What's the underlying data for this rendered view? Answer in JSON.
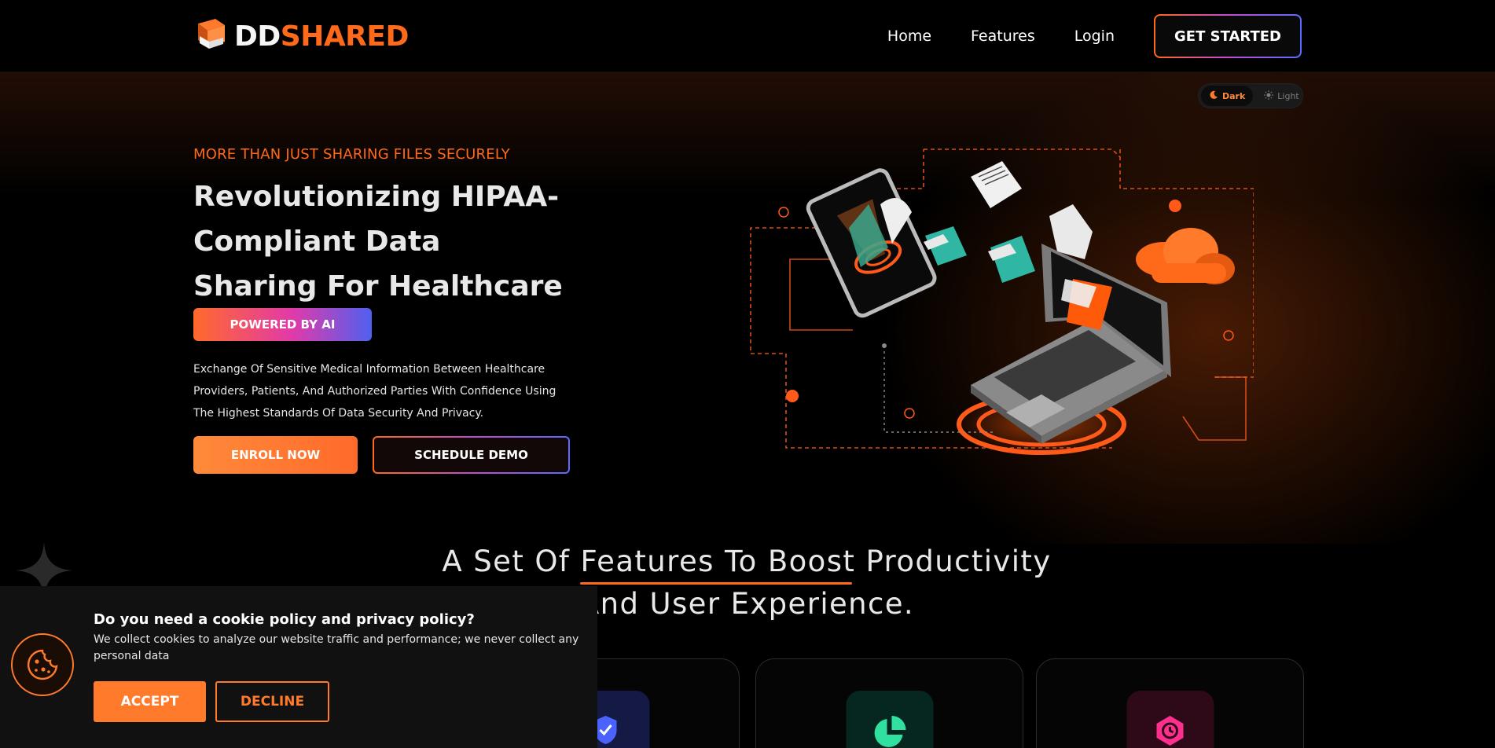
{
  "header": {
    "logo": {
      "part1": "DD",
      "part2": "SHARED"
    },
    "nav": {
      "home": "Home",
      "features": "Features",
      "login": "Login",
      "cta": "GET STARTED"
    }
  },
  "theme_toggle": {
    "dark_label": "Dark",
    "light_label": "Light",
    "selected": "Dark"
  },
  "hero": {
    "eyebrow": "MORE THAN JUST SHARING FILES SECURELY",
    "title": "Revolutionizing HIPAA-Compliant Data Sharing For Healthcare",
    "badge": "POWERED BY AI",
    "description": "Exchange Of Sensitive Medical Information Between Healthcare Providers, Patients, And Authorized Parties With Confidence Using The Highest Standards Of Data Security And Privacy.",
    "enroll_label": "ENROLL NOW",
    "demo_label": "SCHEDULE DEMO"
  },
  "features": {
    "title_line1": "A Set Of Features To Boost Productivity",
    "title_line2": "And User Experience.",
    "cards": [
      {
        "icon": "shield-check-icon",
        "color": "#4a63ff"
      },
      {
        "icon": "pie-chart-icon",
        "color": "#2fe0a0"
      },
      {
        "icon": "clock-shield-icon",
        "color": "#ff2f8e"
      }
    ]
  },
  "cookie_banner": {
    "title": "Do you need a cookie policy and privacy policy?",
    "text": "We collect cookies to analyze our website traffic and performance; we never collect any personal data",
    "accept_label": "ACCEPT",
    "decline_label": "DECLINE"
  },
  "colors": {
    "accent": "#ff6a1a",
    "background": "#000000",
    "banner_bg": "#111111"
  }
}
